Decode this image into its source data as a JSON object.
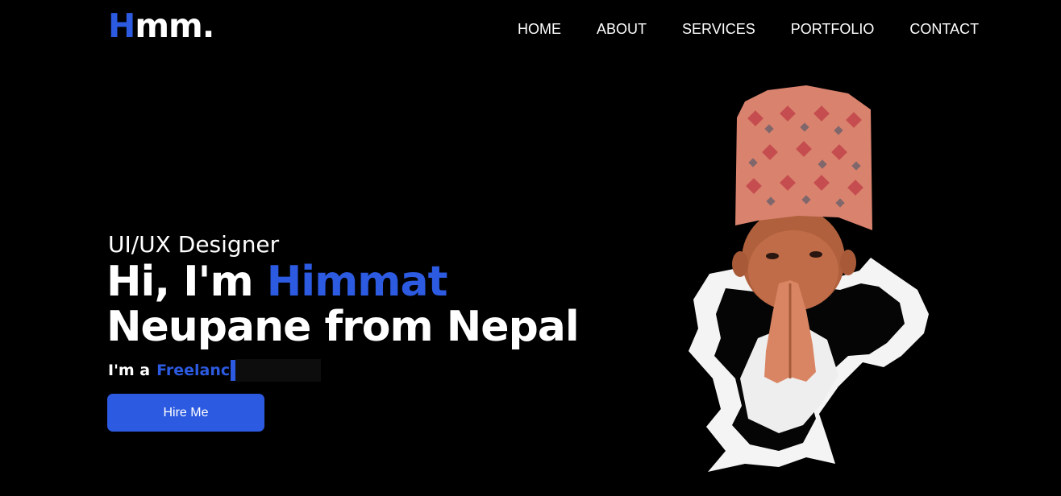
{
  "header": {
    "logo_accent": "H",
    "logo_rest": "mm.",
    "nav": [
      "HOME",
      "ABOUT",
      "SERVICES",
      "PORTFOLIO",
      "CONTACT"
    ]
  },
  "hero": {
    "subtitle": "UI/UX Designer",
    "headline_part1": "Hi, I'm ",
    "headline_highlight": "Himmat",
    "headline_line2": "Neupane from Nepal",
    "typing_prefix": "I'm a",
    "typing_text": "Freelanc",
    "cta_label": "Hire Me"
  },
  "colors": {
    "accent": "#2c5ae0",
    "background": "#000000",
    "text": "#ffffff"
  },
  "icons": {
    "portrait": "portrait-illustration"
  }
}
